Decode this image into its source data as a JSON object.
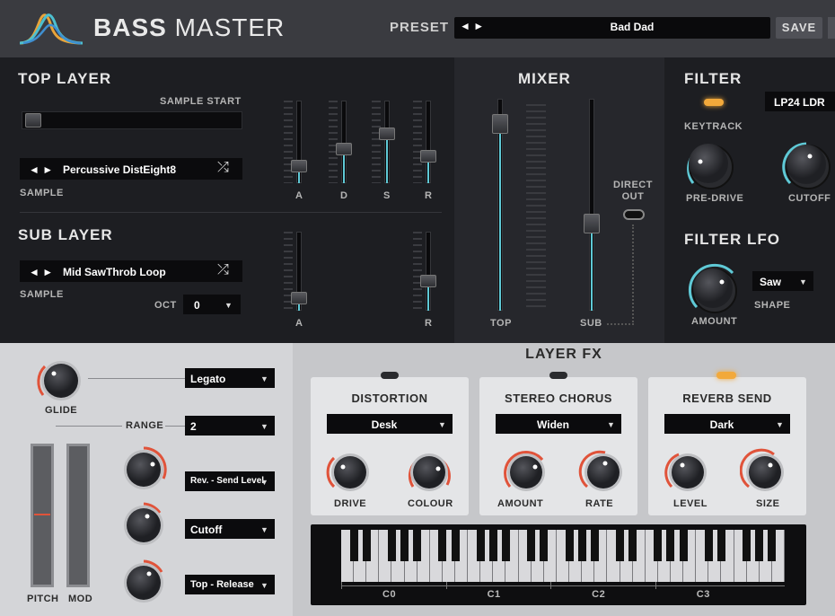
{
  "header": {
    "title_bold": "BASS",
    "title_light": "MASTER",
    "preset_label": "PRESET",
    "preset_arrows": "◄ ►",
    "preset_name": "Bad Dad",
    "save_label": "SAVE"
  },
  "top_layer": {
    "title": "TOP LAYER",
    "sample_start_label": "SAMPLE START",
    "sample_arrows": "◄ ►",
    "sample_name": "Percussive DistEight8",
    "sample_label": "SAMPLE",
    "adsr_labels": [
      "A",
      "D",
      "S",
      "R"
    ],
    "adsr_values": [
      0.15,
      0.4,
      0.62,
      0.3
    ]
  },
  "sub_layer": {
    "title": "SUB LAYER",
    "sample_arrows": "◄ ►",
    "sample_name": "Mid SawThrob Loop",
    "sample_label": "SAMPLE",
    "oct_label": "OCT",
    "oct_value": "0",
    "ar_labels": [
      "A",
      "R"
    ],
    "ar_values": [
      0.1,
      0.35
    ]
  },
  "mixer": {
    "title": "MIXER",
    "top_label": "TOP",
    "sub_label": "SUB",
    "direct_out_label": "DIRECT\nOUT",
    "top_level": 0.92,
    "sub_level": 0.4
  },
  "filter": {
    "title": "FILTER",
    "keytrack_label": "KEYTRACK",
    "type_value": "LP24 LDR",
    "pre_drive_label": "PRE-DRIVE",
    "cutoff_label": "CUTOFF"
  },
  "filter_lfo": {
    "title": "FILTER LFO",
    "shape_value": "Saw",
    "shape_label": "SHAPE",
    "amount_label": "AMOUNT"
  },
  "mod": {
    "glide_label": "GLIDE",
    "mode_value": "Legato",
    "range_label": "RANGE",
    "range_value": "2",
    "dest1_value": "Rev. - Send Level",
    "dest2_value": "Cutoff",
    "dest3_value": "Top - Release",
    "pitch_label": "PITCH",
    "mod_label": "MOD"
  },
  "layer_fx": {
    "title": "LAYER FX",
    "distortion": {
      "title": "DISTORTION",
      "type": "Desk",
      "knob1": "DRIVE",
      "knob2": "COLOUR"
    },
    "chorus": {
      "title": "STEREO CHORUS",
      "type": "Widen",
      "knob1": "AMOUNT",
      "knob2": "RATE"
    },
    "reverb": {
      "title": "REVERB SEND",
      "type": "Dark",
      "knob1": "LEVEL",
      "knob2": "SIZE"
    }
  },
  "keyboard": {
    "octave_labels": [
      "C0",
      "C1",
      "C2",
      "C3"
    ]
  },
  "colors": {
    "accent_cyan": "#5fc9d6",
    "accent_orange": "#f2a93b",
    "knob_arc_red": "#e0533a"
  }
}
